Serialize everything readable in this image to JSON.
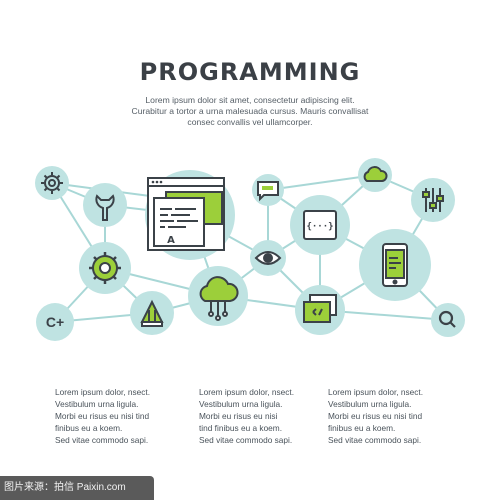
{
  "title": "PROGRAMMING",
  "intro": [
    "Lorem ipsum dolor sit amet, consectetur adipiscing elit.",
    "Curabitur a tortor a urna malesuada cursus. Mauris convallisat",
    "consec convallis vel ullamcorper."
  ],
  "columns": [
    [
      "Lorem ipsum dolor, nsect.",
      "Vestibulum urna ligula.",
      "Morbi eu risus eu nisi tind",
      "finibus eu a koem.",
      "Sed vitae commodo sapi."
    ],
    [
      "Lorem ipsum dolor, nsect.",
      "Vestibulum urna ligula.",
      "Morbi eu risus eu nisi",
      "tind finibus eu a koem.",
      "Sed vitae commodo sapi."
    ],
    [
      "Lorem ipsum dolor, nsect.",
      "Vestibulum urna ligula.",
      "Morbi eu risus eu nisi tind",
      "finibus eu a koem.",
      "Sed vitae commodo sapi."
    ]
  ],
  "icons": {
    "code_label": "{···}",
    "csharp_label": "C+",
    "letter_label": "A"
  },
  "colors": {
    "teal": "#bfe3e2",
    "line": "#a8d7d6",
    "green": "#9ccf3a",
    "stroke": "#3b4248"
  },
  "watermark": "图片来源：拍信 Paixin.com"
}
